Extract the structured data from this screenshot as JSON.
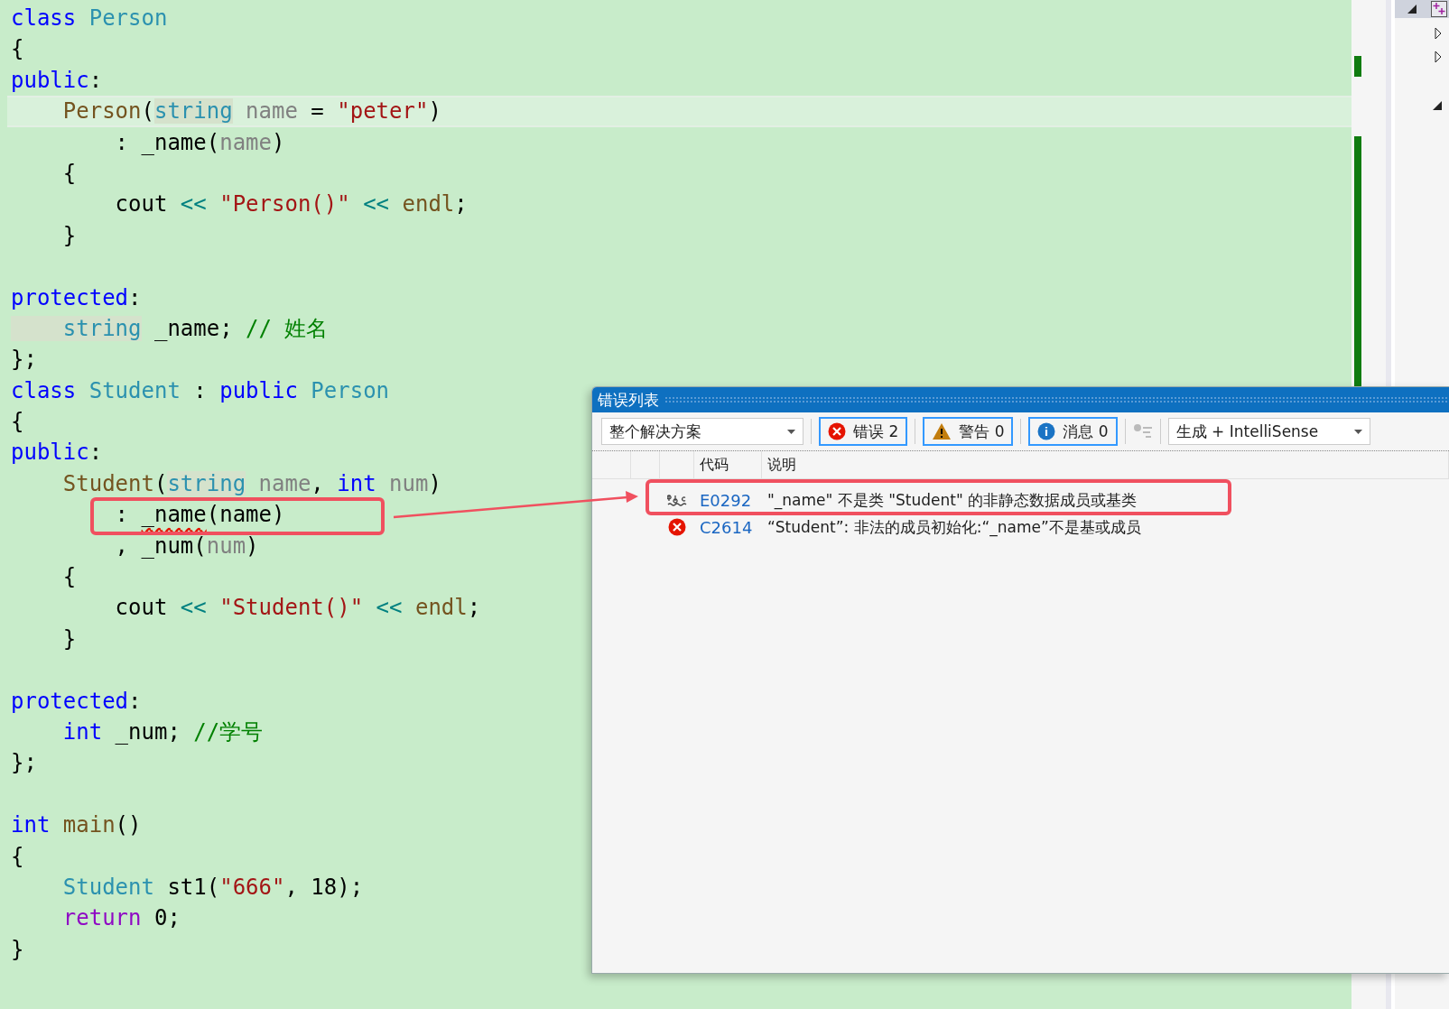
{
  "editor": {
    "lines": [
      {
        "current": false,
        "tokens": [
          {
            "kind": "kw",
            "text": "class"
          },
          {
            "kind": "type",
            "text": " Person"
          }
        ]
      },
      {
        "current": false,
        "tokens": [
          {
            "kind": "plain",
            "text": "{"
          }
        ]
      },
      {
        "current": false,
        "tokens": [
          {
            "kind": "kw",
            "text": "public"
          },
          {
            "kind": "plain",
            "text": ":"
          }
        ]
      },
      {
        "current": true,
        "tokens": [
          {
            "kind": "fn",
            "text": "    Person"
          },
          {
            "kind": "plain",
            "text": "("
          },
          {
            "kind": "ref",
            "text": "string"
          },
          {
            "kind": "param",
            "text": " name"
          },
          {
            "kind": "plain",
            "text": " = "
          },
          {
            "kind": "str",
            "text": "\"peter\""
          },
          {
            "kind": "plain",
            "text": ")"
          }
        ]
      },
      {
        "current": false,
        "tokens": [
          {
            "kind": "plain",
            "text": "        : _name("
          },
          {
            "kind": "param",
            "text": "name"
          },
          {
            "kind": "plain",
            "text": ")"
          }
        ]
      },
      {
        "current": false,
        "tokens": [
          {
            "kind": "plain",
            "text": "    {"
          }
        ]
      },
      {
        "current": false,
        "tokens": [
          {
            "kind": "plain",
            "text": "        cout "
          },
          {
            "kind": "op",
            "text": "<<"
          },
          {
            "kind": "str",
            "text": " \"Person()\""
          },
          {
            "kind": "op",
            "text": " <<"
          },
          {
            "kind": "fn",
            "text": " endl"
          },
          {
            "kind": "plain",
            "text": ";"
          }
        ]
      },
      {
        "current": false,
        "tokens": [
          {
            "kind": "plain",
            "text": "    }"
          }
        ]
      },
      {
        "current": false
      },
      {
        "current": false,
        "tokens": [
          {
            "kind": "kw",
            "text": "protected"
          },
          {
            "kind": "plain",
            "text": ":"
          }
        ]
      },
      {
        "current": false,
        "tokens": [
          {
            "kind": "ref",
            "text": "    string"
          },
          {
            "kind": "plain",
            "text": " _name; "
          },
          {
            "kind": "comment",
            "text": "// 姓名"
          }
        ]
      },
      {
        "current": false,
        "tokens": [
          {
            "kind": "plain",
            "text": "};"
          }
        ]
      },
      {
        "current": false,
        "tokens": [
          {
            "kind": "kw",
            "text": "class"
          },
          {
            "kind": "type",
            "text": " Student"
          },
          {
            "kind": "plain",
            "text": " : "
          },
          {
            "kind": "kw",
            "text": "public"
          },
          {
            "kind": "type",
            "text": " Person"
          }
        ]
      },
      {
        "current": false,
        "tokens": [
          {
            "kind": "plain",
            "text": "{"
          }
        ]
      },
      {
        "current": false,
        "tokens": [
          {
            "kind": "kw",
            "text": "public"
          },
          {
            "kind": "plain",
            "text": ":"
          }
        ]
      },
      {
        "current": false,
        "tokens": [
          {
            "kind": "fn",
            "text": "    Student"
          },
          {
            "kind": "plain",
            "text": "("
          },
          {
            "kind": "ref",
            "text": "string"
          },
          {
            "kind": "param",
            "text": " name"
          },
          {
            "kind": "plain",
            "text": ", "
          },
          {
            "kind": "kw",
            "text": "int"
          },
          {
            "kind": "param",
            "text": " num"
          },
          {
            "kind": "plain",
            "text": ")"
          }
        ]
      },
      {
        "current": false,
        "tokens": [
          {
            "kind": "plain",
            "text": "        : "
          },
          {
            "kind": "error",
            "text": "_name"
          },
          {
            "kind": "plain",
            "text": "(name)"
          }
        ]
      },
      {
        "current": false,
        "tokens": [
          {
            "kind": "plain",
            "text": "        , _num("
          },
          {
            "kind": "param",
            "text": "num"
          },
          {
            "kind": "plain",
            "text": ")"
          }
        ]
      },
      {
        "current": false,
        "tokens": [
          {
            "kind": "plain",
            "text": "    {"
          }
        ]
      },
      {
        "current": false,
        "tokens": [
          {
            "kind": "plain",
            "text": "        cout "
          },
          {
            "kind": "op",
            "text": "<<"
          },
          {
            "kind": "str",
            "text": " \"Student()\""
          },
          {
            "kind": "op",
            "text": " <<"
          },
          {
            "kind": "fn",
            "text": " endl"
          },
          {
            "kind": "plain",
            "text": ";"
          }
        ]
      },
      {
        "current": false,
        "tokens": [
          {
            "kind": "plain",
            "text": "    }"
          }
        ]
      },
      {
        "current": false
      },
      {
        "current": false,
        "tokens": [
          {
            "kind": "kw",
            "text": "protected"
          },
          {
            "kind": "plain",
            "text": ":"
          }
        ]
      },
      {
        "current": false,
        "tokens": [
          {
            "kind": "kw",
            "text": "    int"
          },
          {
            "kind": "plain",
            "text": " _num; "
          },
          {
            "kind": "comment",
            "text": "//学号"
          }
        ]
      },
      {
        "current": false,
        "tokens": [
          {
            "kind": "plain",
            "text": "};"
          }
        ]
      },
      {
        "current": false
      },
      {
        "current": false,
        "tokens": [
          {
            "kind": "kw",
            "text": "int"
          },
          {
            "kind": "fn",
            "text": " main"
          },
          {
            "kind": "plain",
            "text": "()"
          }
        ]
      },
      {
        "current": false,
        "tokens": [
          {
            "kind": "plain",
            "text": "{"
          }
        ]
      },
      {
        "current": false,
        "tokens": [
          {
            "kind": "type",
            "text": "    Student"
          },
          {
            "kind": "plain",
            "text": " st1("
          },
          {
            "kind": "str",
            "text": "\"666\""
          },
          {
            "kind": "plain",
            "text": ", 18);"
          }
        ]
      },
      {
        "current": false,
        "tokens": [
          {
            "kind": "ctrl",
            "text": "    return"
          },
          {
            "kind": "plain",
            "text": " 0;"
          }
        ]
      },
      {
        "current": false,
        "tokens": [
          {
            "kind": "plain",
            "text": "}"
          }
        ]
      }
    ]
  },
  "error_list": {
    "title": "错误列表",
    "scope": {
      "value": "整个解决方案"
    },
    "filters": [
      {
        "kind": "error",
        "label": "错误 2",
        "selected": true
      },
      {
        "kind": "warning",
        "label": "警告 0",
        "selected": true
      },
      {
        "kind": "info",
        "label": "消息 0",
        "selected": true
      }
    ],
    "source": {
      "value": "生成 + IntelliSense"
    },
    "columns": [
      "代码",
      "说明"
    ],
    "rows": [
      {
        "kind": "intellisense",
        "code": "E0292",
        "description": "\"_name\" 不是类 \"Student\" 的非静态数据成员或基类"
      },
      {
        "kind": "error",
        "code": "C2614",
        "description": "“Student”: 非法的成员初始化:“_name”不是基或成员"
      }
    ]
  }
}
